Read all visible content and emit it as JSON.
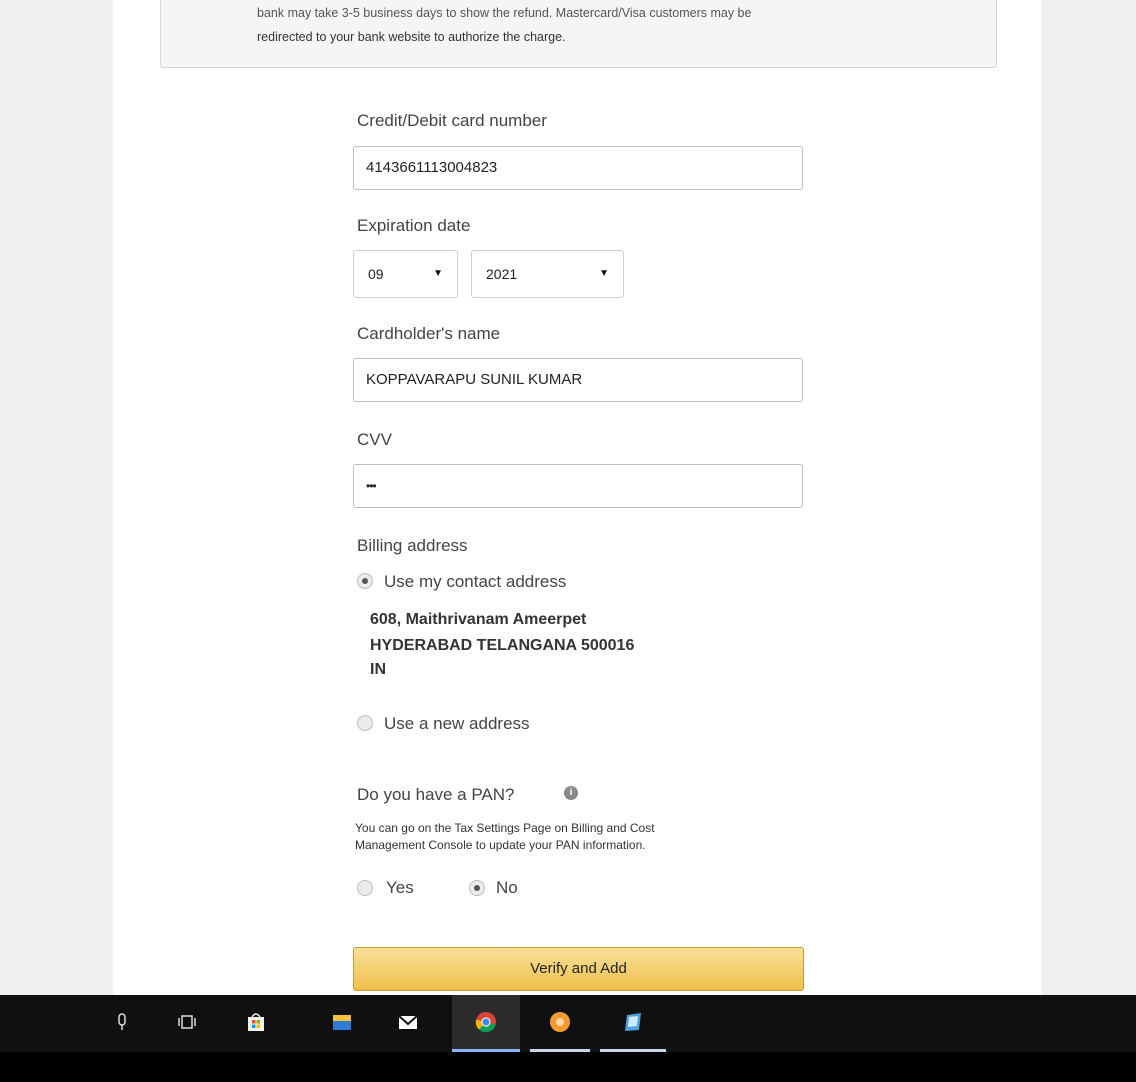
{
  "notice": {
    "line1": "bank may take 3-5 business days to show the refund. Mastercard/Visa customers may be",
    "line2": "redirected to your bank website to authorize the charge."
  },
  "card_number": {
    "label": "Credit/Debit card number",
    "value": "4143661113004823"
  },
  "expiration": {
    "label": "Expiration date",
    "month": "09",
    "year": "2021"
  },
  "cardholder": {
    "label": "Cardholder's name",
    "value": "KOPPAVARAPU SUNIL KUMAR"
  },
  "cvv": {
    "label": "CVV",
    "value": "•••"
  },
  "billing": {
    "label": "Billing address",
    "option_contact": "Use my contact address",
    "address_line1": "608, Maithrivanam Ameerpet",
    "address_line2": "HYDERABAD TELANGANA 500016",
    "address_line3": "IN",
    "option_new": "Use a new address",
    "selected": "contact"
  },
  "pan": {
    "question": "Do you have a PAN?",
    "info_glyph": "i",
    "help_line1": "You can go on the Tax Settings Page on Billing and Cost",
    "help_line2": "Management Console to update your PAN information.",
    "yes_label": "Yes",
    "no_label": "No",
    "selected": "no"
  },
  "verify_button": "Verify and Add",
  "taskbar": {
    "icons": [
      "microphone-icon",
      "task-view-icon",
      "store-icon",
      "file-explorer-icon",
      "mail-icon",
      "chrome-icon",
      "orange-app-icon",
      "notepad-app-icon"
    ],
    "active": "chrome-icon"
  },
  "colors": {
    "button_top": "#f7df9a",
    "button_bottom": "#f0c14b",
    "taskbar": "#101010",
    "accent_underline": "#8ab4f8"
  }
}
